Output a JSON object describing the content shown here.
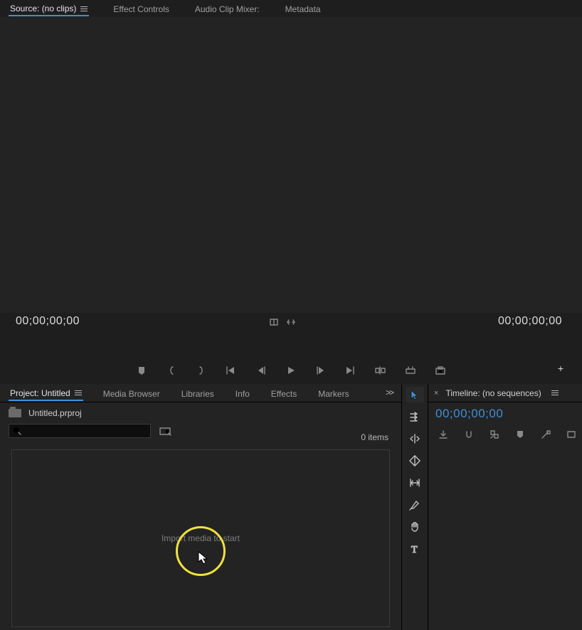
{
  "source": {
    "tabs": {
      "source": "Source: (no clips)",
      "effect_controls": "Effect Controls",
      "audio_mixer": "Audio Clip Mixer:",
      "metadata": "Metadata"
    },
    "timecode_left": "00;00;00;00",
    "timecode_right": "00;00;00;00"
  },
  "project": {
    "tabs": {
      "project": "Project: Untitled",
      "media_browser": "Media Browser",
      "libraries": "Libraries",
      "info": "Info",
      "effects": "Effects",
      "markers": "Markers"
    },
    "overflow_glyph": ">>",
    "file_name": "Untitled.prproj",
    "search_placeholder": "",
    "items_count": "0 items",
    "drop_hint": "Import media to start"
  },
  "timeline": {
    "title": "Timeline: (no sequences)",
    "timecode": "00;00;00;00"
  },
  "icons": {
    "burger": "panel-menu-icon",
    "plus": "+"
  }
}
